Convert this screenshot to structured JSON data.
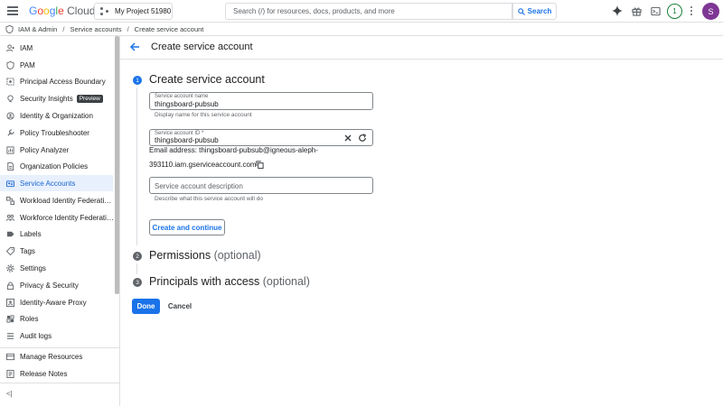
{
  "topbar": {
    "logo_parts": [
      "G",
      "o",
      "o",
      "g",
      "l",
      "e"
    ],
    "logo_suffix": "Cloud",
    "project": "My Project 51980",
    "search_placeholder": "Search (/) for resources, docs, products, and more",
    "search_button": "Search",
    "notifications_count": "1",
    "avatar_initial": "S"
  },
  "breadcrumb": {
    "items": [
      "IAM & Admin",
      "Service accounts",
      "Create service account"
    ],
    "separator": "/"
  },
  "sidebar": {
    "items": [
      {
        "label": "IAM",
        "icon": "person-add-icon"
      },
      {
        "label": "PAM",
        "icon": "shield-icon"
      },
      {
        "label": "Principal Access Boundary",
        "icon": "boundary-icon"
      },
      {
        "label": "Security Insights",
        "icon": "insights-icon",
        "badge": "Preview"
      },
      {
        "label": "Identity & Organization",
        "icon": "identity-icon"
      },
      {
        "label": "Policy Troubleshooter",
        "icon": "wrench-icon"
      },
      {
        "label": "Policy Analyzer",
        "icon": "analyzer-icon"
      },
      {
        "label": "Organization Policies",
        "icon": "document-icon"
      },
      {
        "label": "Service Accounts",
        "icon": "service-account-icon",
        "active": true
      },
      {
        "label": "Workload Identity Federati…",
        "icon": "workload-icon"
      },
      {
        "label": "Workforce Identity Federati…",
        "icon": "workforce-icon"
      },
      {
        "label": "Labels",
        "icon": "label-icon"
      },
      {
        "label": "Tags",
        "icon": "tag-icon"
      },
      {
        "label": "Settings",
        "icon": "gear-icon"
      },
      {
        "label": "Privacy & Security",
        "icon": "lock-icon"
      },
      {
        "label": "Identity-Aware Proxy",
        "icon": "proxy-icon"
      },
      {
        "label": "Roles",
        "icon": "roles-icon"
      },
      {
        "label": "Audit logs",
        "icon": "list-icon"
      }
    ],
    "footer_items": [
      {
        "label": "Manage Resources",
        "icon": "resources-icon"
      },
      {
        "label": "Release Notes",
        "icon": "notes-icon"
      }
    ],
    "collapse_label": "<|"
  },
  "main": {
    "title": "Create service account",
    "steps": [
      {
        "number": "1",
        "title": "Create service account",
        "optional": ""
      },
      {
        "number": "2",
        "title": "Permissions",
        "optional": "(optional)"
      },
      {
        "number": "3",
        "title": "Principals with access",
        "optional": "(optional)"
      }
    ],
    "form": {
      "name_label": "Service account name",
      "name_value": "thingsboard-pubsub",
      "name_hint": "Display name for this service account",
      "id_label": "Service account ID *",
      "id_value": "thingsboard-pubsub",
      "email_line1": "Email address: thingsboard-pubsub@igneous-aleph-",
      "email_line2": "393110.iam.gserviceaccount.com",
      "description_placeholder": "Service account description",
      "description_hint": "Describe what this service account will do",
      "create_button": "Create and continue"
    },
    "done_button": "Done",
    "cancel_button": "Cancel"
  },
  "colors": {
    "accent": "#1a73e8",
    "active_bg": "#e8f0fe",
    "avatar": "#7e3794",
    "notification": "#188038"
  }
}
